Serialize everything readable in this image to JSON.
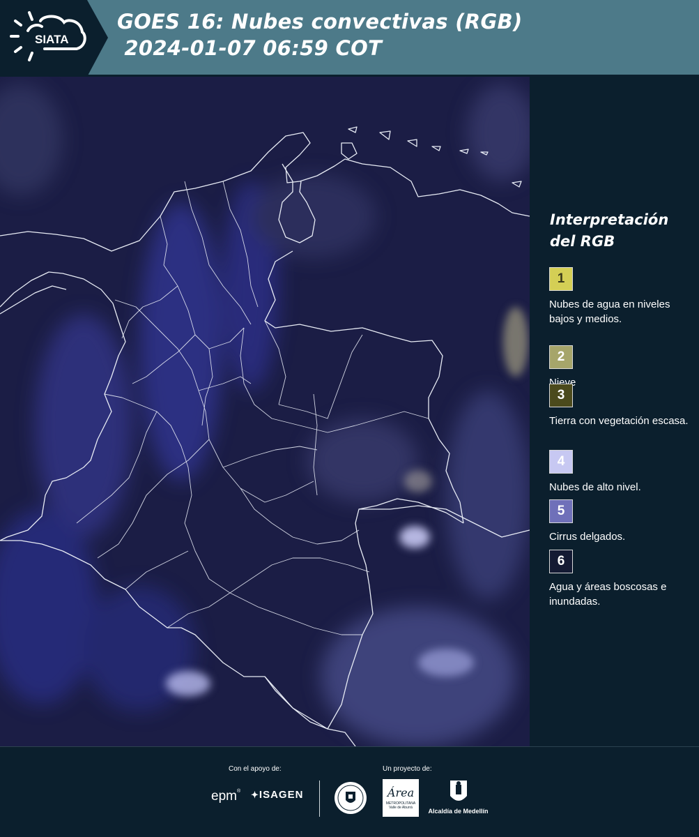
{
  "header": {
    "title_line1": "GOES 16: Nubes convectivas (RGB)",
    "title_line2": " 2024-01-07 06:59 COT",
    "logo_text": "SIATA",
    "logo_icon": "sun-cloud-icon"
  },
  "map": {
    "region": "Colombia",
    "background_color": "#1b1d45",
    "border_color": "#e8ecf5",
    "cloud_color": "#a9b3ea",
    "low_cloud_color": "#c9c68a"
  },
  "legend": {
    "title": "Interpretación del RGB",
    "items": [
      {
        "number": "1",
        "description": "Nubes de agua en niveles bajos y medios.",
        "color": "#d4cf55",
        "text_color": "#3a3a1a"
      },
      {
        "number": "2",
        "description": "Nieve",
        "color": "#a6a56a",
        "text_color": "#ffffff"
      },
      {
        "number": "3",
        "description": "Tierra con vegetación escasa.",
        "color": "#4b4a1c",
        "text_color": "#ffffff"
      },
      {
        "number": "4",
        "description": "Nubes de alto nivel.",
        "color": "#c7c8f2",
        "text_color": "#ffffff"
      },
      {
        "number": "5",
        "description": "Cirrus delgados.",
        "color": "#6f70b9",
        "text_color": "#ffffff"
      },
      {
        "number": "6",
        "description": "Agua y áreas boscosas e inundadas.",
        "color": "#141a33",
        "text_color": "#ffffff"
      }
    ]
  },
  "footer": {
    "support_label": "Con el apoyo de:",
    "project_label": "Un proyecto de:",
    "sponsor_epm": "epm",
    "sponsor_isagen": "ISAGEN",
    "area_logo": "Área",
    "area_sub1": "METROPOLITANA",
    "area_sub2": "Valle de Aburrá",
    "alcaldia": "Alcaldía de Medellín"
  }
}
